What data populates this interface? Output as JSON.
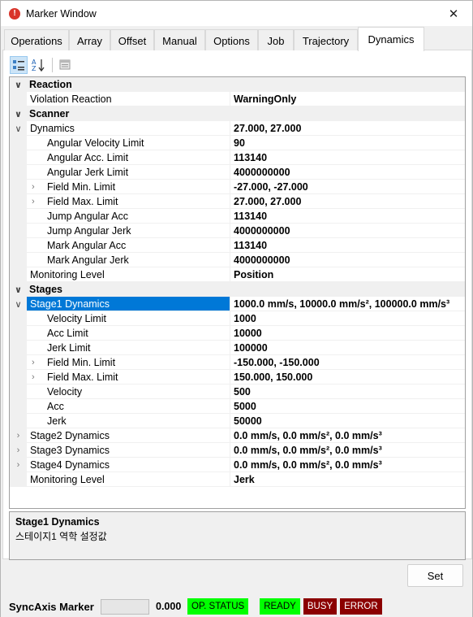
{
  "window": {
    "title": "Marker Window",
    "close_glyph": "✕"
  },
  "tabs": [
    {
      "label": "Operations"
    },
    {
      "label": "Array"
    },
    {
      "label": "Offset"
    },
    {
      "label": "Manual"
    },
    {
      "label": "Options"
    },
    {
      "label": "Job"
    },
    {
      "label": "Trajectory"
    },
    {
      "label": "Dynamics",
      "active": true
    }
  ],
  "toolbar": {
    "categorized_icon": "categorized-view-icon",
    "alphabetical_icon": "alphabetical-sort-icon",
    "pages_icon": "property-pages-icon"
  },
  "grid": {
    "reaction": {
      "category": "Reaction",
      "violation_reaction": {
        "name": "Violation Reaction",
        "value": "WarningOnly"
      }
    },
    "scanner": {
      "category": "Scanner",
      "dynamics": {
        "name": "Dynamics",
        "value": "27.000, 27.000"
      },
      "angular_velocity_limit": {
        "name": "Angular Velocity Limit",
        "value": "90"
      },
      "angular_acc_limit": {
        "name": "Angular Acc. Limit",
        "value": "113140"
      },
      "angular_jerk_limit": {
        "name": "Angular Jerk Limit",
        "value": "4000000000"
      },
      "field_min_limit": {
        "name": "Field Min. Limit",
        "value": "-27.000, -27.000"
      },
      "field_max_limit": {
        "name": "Field Max. Limit",
        "value": "27.000, 27.000"
      },
      "jump_angular_acc": {
        "name": "Jump Angular Acc",
        "value": "113140"
      },
      "jump_angular_jerk": {
        "name": "Jump Angular Jerk",
        "value": "4000000000"
      },
      "mark_angular_acc": {
        "name": "Mark Angular Acc",
        "value": "113140"
      },
      "mark_angular_jerk": {
        "name": "Mark Angular Jerk",
        "value": "4000000000"
      },
      "monitoring_level": {
        "name": "Monitoring Level",
        "value": "Position"
      }
    },
    "stages": {
      "category": "Stages",
      "stage1": {
        "name": "Stage1 Dynamics",
        "value": "1000.0 mm/s, 10000.0 mm/s², 100000.0 mm/s³"
      },
      "velocity_limit": {
        "name": "Velocity Limit",
        "value": "1000"
      },
      "acc_limit": {
        "name": "Acc Limit",
        "value": "10000"
      },
      "jerk_limit": {
        "name": "Jerk Limit",
        "value": "100000"
      },
      "field_min_limit": {
        "name": "Field Min. Limit",
        "value": "-150.000, -150.000"
      },
      "field_max_limit": {
        "name": "Field Max. Limit",
        "value": "150.000, 150.000"
      },
      "velocity": {
        "name": "Velocity",
        "value": "500"
      },
      "acc": {
        "name": "Acc",
        "value": "5000"
      },
      "jerk": {
        "name": "Jerk",
        "value": "50000"
      },
      "stage2": {
        "name": "Stage2 Dynamics",
        "value": "0.0 mm/s, 0.0 mm/s², 0.0 mm/s³"
      },
      "stage3": {
        "name": "Stage3 Dynamics",
        "value": "0.0 mm/s, 0.0 mm/s², 0.0 mm/s³"
      },
      "stage4": {
        "name": "Stage4 Dynamics",
        "value": "0.0 mm/s, 0.0 mm/s², 0.0 mm/s³"
      },
      "monitoring_level": {
        "name": "Monitoring Level",
        "value": "Jerk"
      }
    }
  },
  "description": {
    "title": "Stage1 Dynamics",
    "text": "스테이지1 역학 설정값"
  },
  "buttons": {
    "set": "Set"
  },
  "statusbar": {
    "title": "SyncAxis Marker",
    "value": "0.000",
    "op_status": "OP. STATUS",
    "ready": "READY",
    "busy": "BUSY",
    "error": "ERROR"
  },
  "colors": {
    "selection": "#0078d7",
    "status_green": "#00ff00",
    "status_red": "#8b0000",
    "app_icon": "#d9352b"
  }
}
